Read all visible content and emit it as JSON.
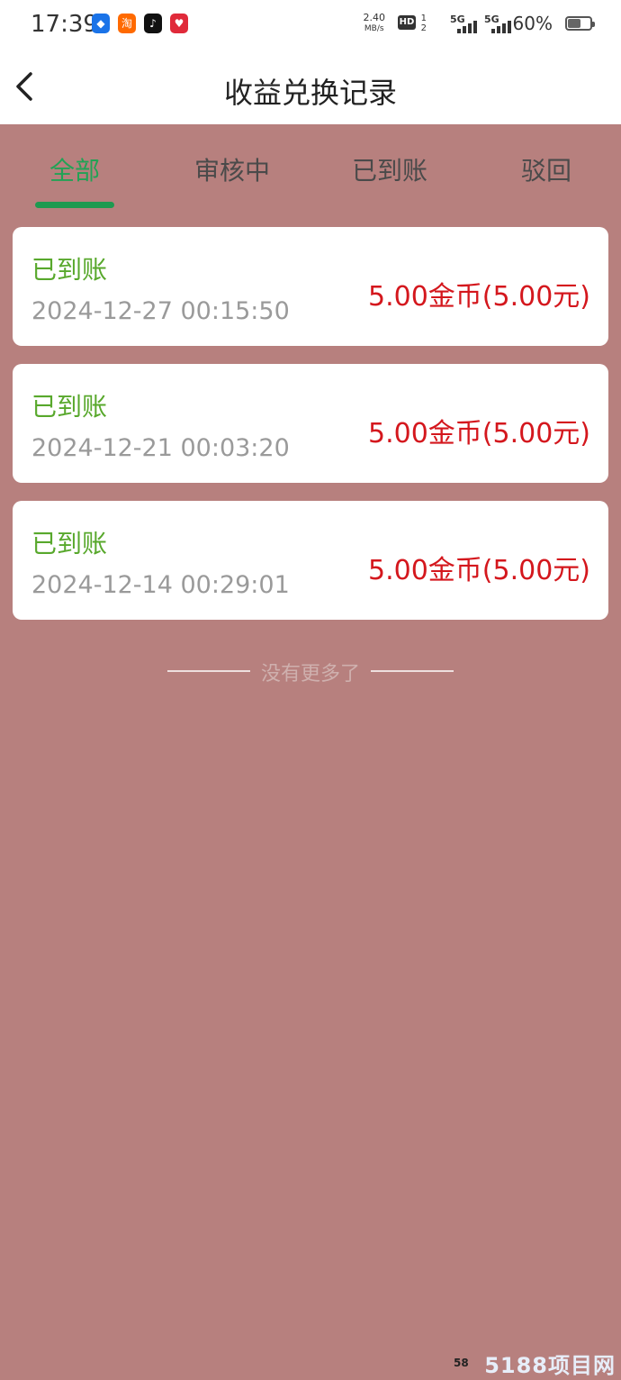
{
  "status_bar": {
    "time": "17:39",
    "net_speed_value": "2.40",
    "net_speed_unit": "MB/s",
    "hd_label": "HD",
    "hd_sub_top": "1",
    "hd_sub_bottom": "2",
    "sim1_label": "5G",
    "sim2_label": "5G",
    "battery_percent": "60%",
    "battery_level": 0.6,
    "app_icons": [
      {
        "name": "shield-app-icon",
        "glyph": "◆",
        "color": "#1a73e8"
      },
      {
        "name": "taobao-app-icon",
        "glyph": "淘",
        "color": "#ff6a00"
      },
      {
        "name": "douyin-app-icon",
        "glyph": "♪",
        "color": "#111111"
      },
      {
        "name": "heart-app-icon",
        "glyph": "♥",
        "color": "#e02a3a"
      }
    ]
  },
  "header": {
    "title": "收益兑换记录"
  },
  "tabs": [
    {
      "label": "全部",
      "active": true
    },
    {
      "label": "审核中",
      "active": false
    },
    {
      "label": "已到账",
      "active": false
    },
    {
      "label": "驳回",
      "active": false
    }
  ],
  "records": [
    {
      "status": "已到账",
      "time": "2024-12-27 00:15:50",
      "amount": "5.00金币(5.00元)"
    },
    {
      "status": "已到账",
      "time": "2024-12-21 00:03:20",
      "amount": "5.00金币(5.00元)"
    },
    {
      "status": "已到账",
      "time": "2024-12-14 00:29:01",
      "amount": "5.00金币(5.00元)"
    }
  ],
  "footer": {
    "end_text": "没有更多了"
  },
  "watermark": {
    "small": "58",
    "text": "5188项目网"
  },
  "colors": {
    "background": "#b7807e",
    "tab_active": "#22a255",
    "status_green": "#58a82c",
    "amount_red": "#d4171d"
  }
}
